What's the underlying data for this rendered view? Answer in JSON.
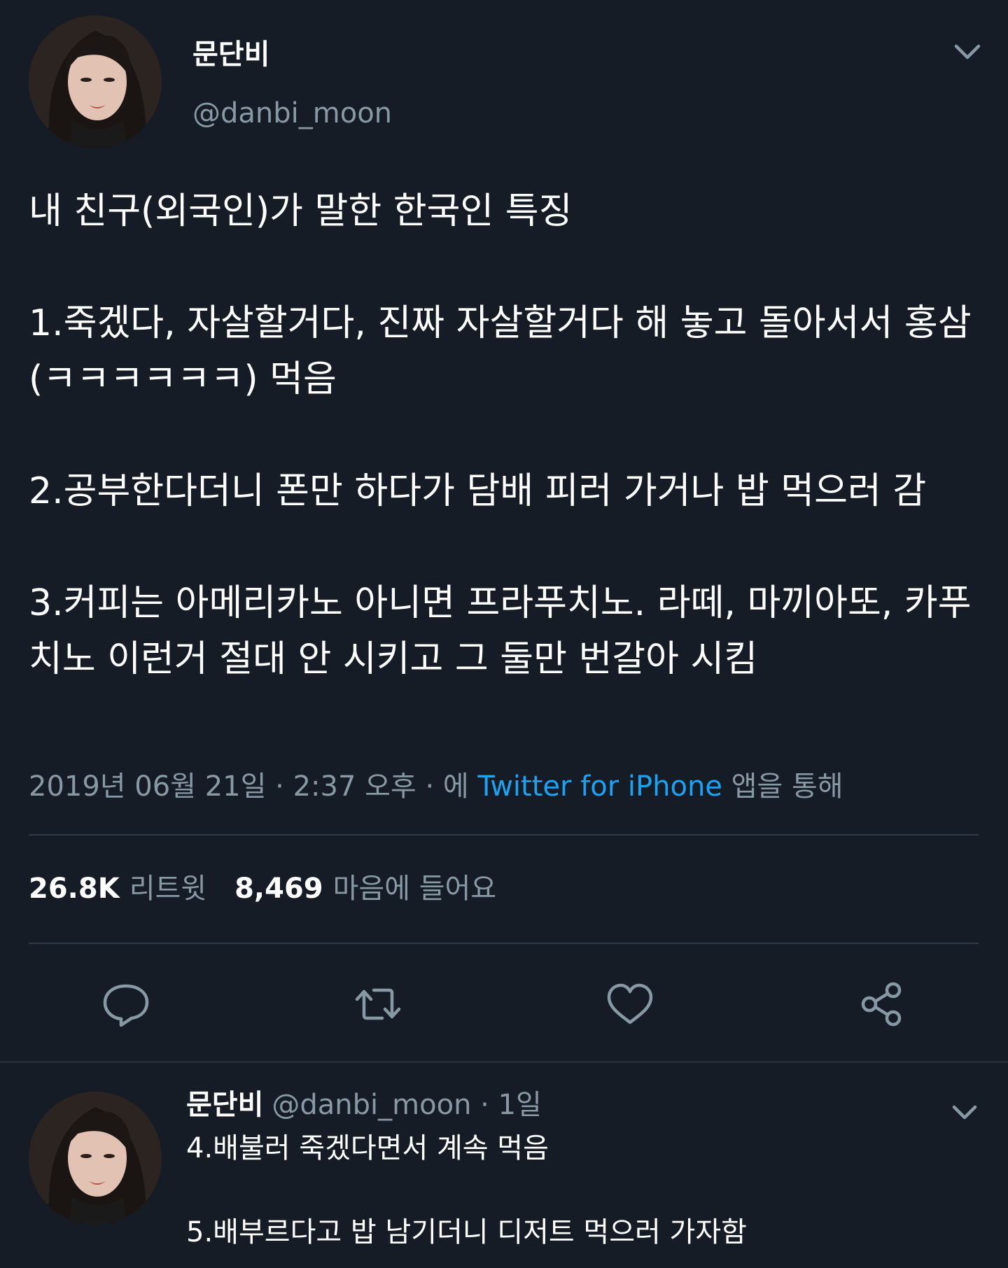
{
  "colors": {
    "background": "#161c26",
    "text_primary": "#ffffff",
    "text_secondary": "#8899a6",
    "link": "#1da1f2",
    "divider": "#2f3a47"
  },
  "main_tweet": {
    "avatar_icon": "profile-photo",
    "display_name": "문단비",
    "handle": "@danbi_moon",
    "menu_icon": "chevron-down-icon",
    "body": "내 친구(외국인)가 말한 한국인 특징\n\n1.죽겠다, 자살할거다, 진짜 자살할거다 해 놓고 돌아서서 홍삼(ㅋㅋㅋㅋㅋㅋ) 먹음\n\n2.공부한다더니 폰만 하다가 담배 피러 가거나 밥 먹으러 감\n\n3.커피는 아메리카노 아니면 프라푸치노. 라떼, 마끼아또, 카푸치노 이런거 절대 안 시키고 그 둘만 번갈아 시킴",
    "meta": {
      "date": "2019년 06월 21일",
      "sep1": " · ",
      "time": "2:37 오후",
      "sep2": " · ",
      "via_prefix": "에 ",
      "client": "Twitter for iPhone",
      "via_suffix": " 앱을 통해"
    },
    "stats": {
      "retweets_count": "26.8K",
      "retweets_label": "리트윗",
      "likes_count": "8,469",
      "likes_label": "마음에 들어요"
    },
    "actions": {
      "reply_icon": "reply-icon",
      "retweet_icon": "retweet-icon",
      "like_icon": "heart-icon",
      "share_icon": "share-icon"
    }
  },
  "reply_tweet": {
    "avatar_icon": "profile-photo",
    "display_name": "문단비",
    "handle_time": "@danbi_moon · 1일",
    "menu_icon": "chevron-down-icon",
    "body": "4.배불러 죽겠다면서 계속 먹음\n\n5.배부르다고 밥 남기더니 디저트 먹으러 가자함"
  }
}
